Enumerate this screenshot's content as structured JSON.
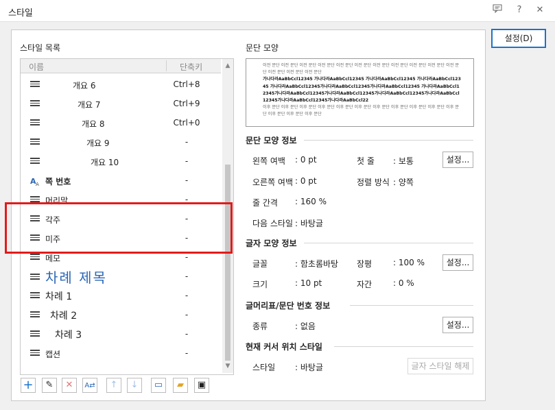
{
  "window": {
    "title": "스타일"
  },
  "buttons": {
    "set": "설정(D)",
    "set_para": "설정...",
    "set_char": "설정...",
    "set_num": "설정...",
    "char_style_off": "글자 스타일 해제"
  },
  "style_list": {
    "heading": "스타일 목록",
    "col_name": "이름",
    "col_key": "단축키",
    "items": [
      {
        "name": "개요 6",
        "key": "Ctrl+8"
      },
      {
        "name": "개요 7",
        "key": "Ctrl+9"
      },
      {
        "name": "개요 8",
        "key": "Ctrl+0"
      },
      {
        "name": "개요 9",
        "key": "-"
      },
      {
        "name": "개요 10",
        "key": "-"
      },
      {
        "name": "쪽 번호",
        "key": "-"
      },
      {
        "name": "머리말",
        "key": "-"
      },
      {
        "name": "각주",
        "key": "-"
      },
      {
        "name": "미주",
        "key": "-"
      },
      {
        "name": "메모",
        "key": "-"
      },
      {
        "name": "차례 제목",
        "key": "-"
      },
      {
        "name": "차례 1",
        "key": "-"
      },
      {
        "name": "차례 2",
        "key": "-"
      },
      {
        "name": "차례 3",
        "key": "-"
      },
      {
        "name": "캡션",
        "key": "-"
      }
    ]
  },
  "preview": {
    "heading": "문단 모양",
    "prev_text": "이전 문단 이전 문단 이전 문단 이전 문단 이전 문단 이전 문단 이전 문단 이전 문단 이전 문단 이전 문단 이전 문단 이전 문단 이전 문단 이전 문단",
    "cur_text": "가나다라AaBbCcl12345 가나다라AaBbCcl12345 가나다라AaBbCcl12345 가나다라AaBbCcl12345 가나다라AaBbCcl12345가나다라AaBbCcl12345가나다라AaBbCcl12345 가나다라AaBbCcl12345가나다라AaBbCcl12345가나다라AaBbCcl12345가나다라AaBbCcl12345가나다라AaBbCcl12345가나다라AaBbCcl12345가나다라AaBbCcl22",
    "next_text": "이후 문단 이후 문단 이후 문단 이후 문단 이후 문단 이후 문단 이후 문단 이후 문단 이후 문단 이후 문단 이후 문단 이후 문단 이후 문단 이후 문단"
  },
  "para_info": {
    "heading": "문단 모양 정보",
    "left_margin_label": "왼쪽 여백",
    "left_margin": ": 0 pt",
    "first_line_label": "첫 줄",
    "first_line": ": 보통",
    "right_margin_label": "오른쪽 여백",
    "right_margin": ": 0 pt",
    "align_label": "정렬 방식",
    "align": ": 양쪽",
    "line_spacing_label": "줄 간격",
    "line_spacing": ": 160 %",
    "next_style_label": "다음 스타일",
    "next_style": ": 바탕글"
  },
  "char_info": {
    "heading": "글자 모양 정보",
    "font_label": "글꼴",
    "font": ": 함초롬바탕",
    "width_label": "장평",
    "width": ": 100 %",
    "size_label": "크기",
    "size": ": 10 pt",
    "spacing_label": "자간",
    "spacing": ": 0 %"
  },
  "numbering": {
    "heading": "글머리표/문단 번호 정보",
    "type_label": "종류",
    "type": ": 없음"
  },
  "cursor": {
    "heading": "현재 커서 위치 스타일",
    "style_label": "스타일",
    "style": ": 바탕글"
  },
  "colors": {
    "accent": "#1a73c9",
    "highlight": "#e21a1a",
    "toc_title": "#2a66b4"
  }
}
